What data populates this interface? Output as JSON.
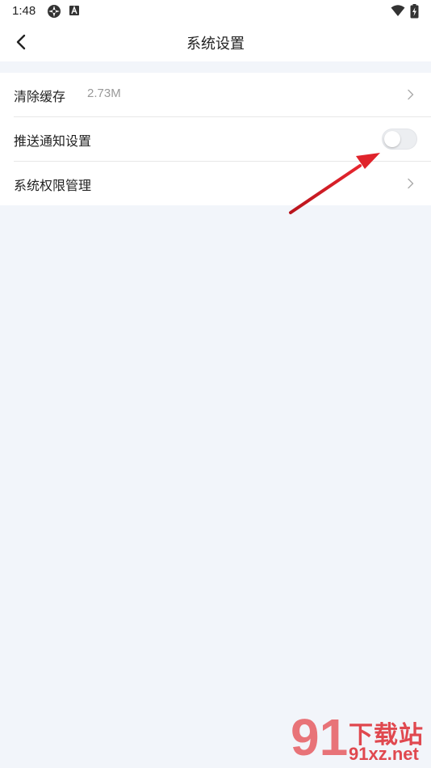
{
  "status_bar": {
    "time": "1:48"
  },
  "header": {
    "title": "系统设置"
  },
  "settings": {
    "items": [
      {
        "label": "清除缓存",
        "value": "2.73M"
      },
      {
        "label": "推送通知设置",
        "toggle_on": false
      },
      {
        "label": "系统权限管理"
      }
    ]
  },
  "watermark": {
    "number": "91",
    "site_name": "下载站",
    "domain": "91xz.net"
  },
  "colors": {
    "background": "#f2f5fa",
    "annotation_arrow": "#d81e28",
    "watermark": "#e0484f"
  }
}
